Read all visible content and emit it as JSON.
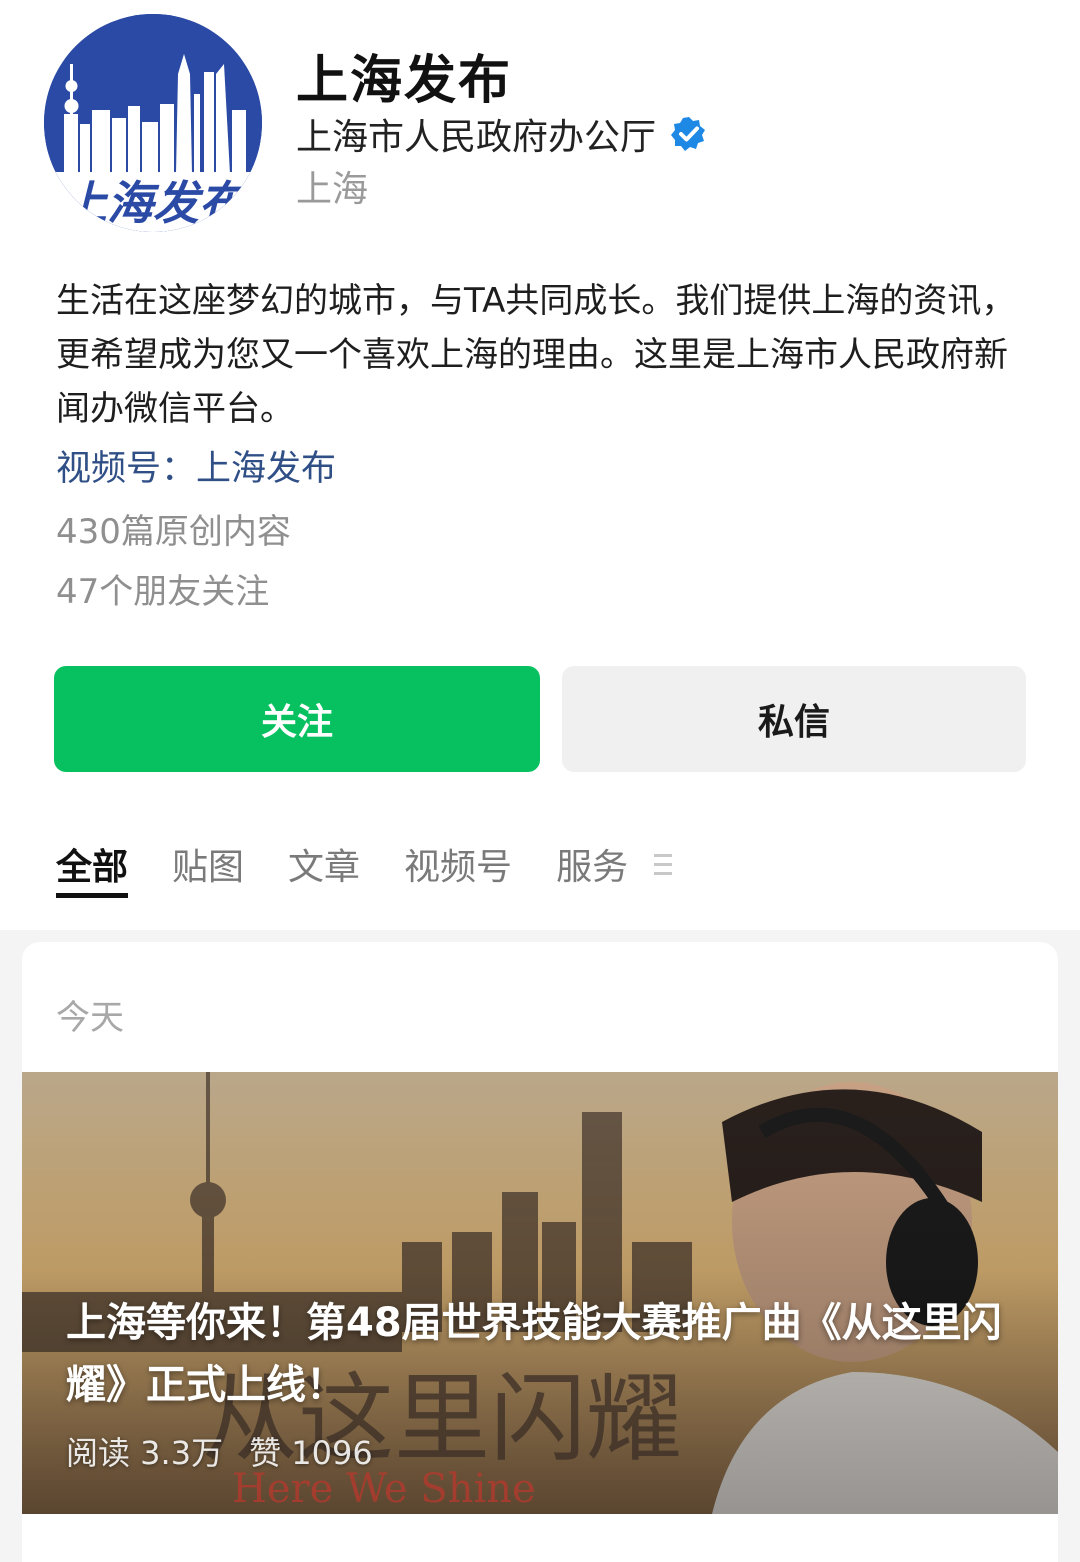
{
  "profile": {
    "name": "上海发布",
    "avatar_text": "上海发布",
    "organization": "上海市人民政府办公厅",
    "verified_icon": "verified-badge-icon",
    "region": "上海",
    "bio": "生活在这座梦幻的城市，与TA共同成长。我们提供上海的资讯，更希望成为您又一个喜欢上海的理由。这里是上海市人民政府新闻办微信平台。",
    "channels_label": "视频号：上海发布",
    "original_count": "430篇原创内容",
    "friends_following": "47个朋友关注"
  },
  "actions": {
    "follow_label": "关注",
    "message_label": "私信"
  },
  "tabs": [
    {
      "label": "全部",
      "active": true
    },
    {
      "label": "贴图",
      "active": false
    },
    {
      "label": "文章",
      "active": false
    },
    {
      "label": "视频号",
      "active": false
    },
    {
      "label": "服务",
      "active": false
    }
  ],
  "feed": {
    "date_label": "今天",
    "article": {
      "title": "上海等你来！第48届世界技能大赛推广曲《从这里闪耀》正式上线！",
      "reads": "阅读 3.3万",
      "likes": "赞 1096",
      "cover_text_cn": "从这里闪耀",
      "cover_text_en": "Here We Shine"
    }
  },
  "colors": {
    "primary_green": "#07c160",
    "link_blue": "#2f4f86",
    "verified_blue": "#1e88e5"
  }
}
